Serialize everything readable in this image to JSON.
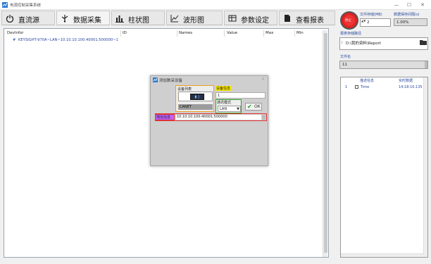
{
  "window": {
    "title": "电源控制采集系统",
    "minimize": "—",
    "maximize": "☐",
    "close": "✕"
  },
  "tabs": [
    {
      "label": "直流源",
      "icon": "power-icon"
    },
    {
      "label": "数据采集",
      "icon": "usb-icon"
    },
    {
      "label": "柱状图",
      "icon": "bar-chart-icon"
    },
    {
      "label": "波形图",
      "icon": "line-chart-icon"
    },
    {
      "label": "参数设定",
      "icon": "table-icon"
    },
    {
      "label": "查看报表",
      "icon": "document-icon"
    }
  ],
  "grid": {
    "columns": [
      "DevInfor",
      "ID",
      "Names",
      "Value",
      "Max",
      "Min"
    ],
    "rows": [
      {
        "marker": "#",
        "devinfo": "KEYSIGHT-970A~LAN~10.10.10.100:40001:500000~1"
      }
    ]
  },
  "dialog": {
    "title": "添加数采设备",
    "close": "×",
    "device_list_label": "设备列表",
    "device_chip": "▮ ▯",
    "device_name": "CANET",
    "device_info_label": "设备信息",
    "device_info_value": "1",
    "comm_mode_label": "通讯模式",
    "comm_mode_value": "LAN",
    "ok_check": "✔",
    "ok_label": "OK",
    "address_label": "地址信息",
    "address_value": "10.10.10.100:40001:500000"
  },
  "right_panel": {
    "stop_label": "停止",
    "interval_label": "文件存储(MB)",
    "interval_arrows": "▲▼",
    "interval_value": "2",
    "storage_label": "数据保存间隔(s)",
    "storage_value": "1.00%",
    "path_label": "报表存储路径",
    "path_handle": "⁞",
    "path_value": "D:\\我的资料\\Report",
    "filename_label": "文件名",
    "filename_value": "11",
    "list_columns": [
      "描述信息",
      "实时数据"
    ],
    "list_rows": [
      {
        "index": "1",
        "desc": "Time",
        "value": "14:18:10.135"
      }
    ]
  }
}
